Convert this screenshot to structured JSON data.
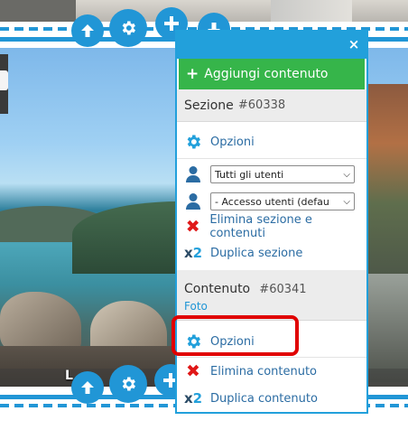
{
  "toolbar_top": [
    "arrow-up-icon",
    "gear-icon",
    "plus-icon",
    "arrow-down-icon"
  ],
  "toolbar_bottom": [
    "arrow-up-icon",
    "gear-icon",
    "plus-icon"
  ],
  "photo_caption": "L",
  "panel": {
    "close_label": "×",
    "add_button_label": "Aggiungi contenuto",
    "section": {
      "title": "Sezione",
      "id": "#60338",
      "options_label": "Opzioni",
      "audience_select": "Tutti gli utenti",
      "access_select": "- Accesso utenti (defau",
      "delete_label": "Elimina sezione e contenuti",
      "duplicate_label": "Duplica sezione"
    },
    "content": {
      "title": "Contenuto",
      "id": "#60341",
      "type": "Foto",
      "options_label": "Opzioni",
      "delete_label": "Elimina contenuto",
      "duplicate_label": "Duplica contenuto"
    },
    "x2_label": "x2"
  },
  "colors": {
    "accent": "#22a0db",
    "add_green": "#36b54a",
    "highlight_red": "#e00000",
    "delete_red": "#e01818"
  }
}
